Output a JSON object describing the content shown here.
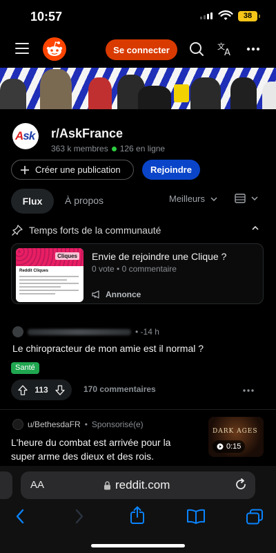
{
  "status_bar": {
    "time": "10:57",
    "battery": "38"
  },
  "header": {
    "connect_label": "Se connecter"
  },
  "community": {
    "avatar_text_a": "A",
    "avatar_text_sk": "sk",
    "name": "r/AskFrance",
    "members": "363 k membres",
    "online": "126 en ligne",
    "create_post_label": "Créer une publication",
    "join_label": "Rejoindre"
  },
  "tabs": {
    "feed": "Flux",
    "about": "À propos",
    "sort": "Meilleurs"
  },
  "highlights": {
    "title": "Temps forts de la communauté",
    "card": {
      "title": "Envie de rejoindre une Clique ?",
      "votes": "0 vote",
      "comments": "0 commentaire",
      "announcement": "Annonce",
      "thumb_label": "Cliques",
      "thumb_heading": "Reddit Cliques"
    }
  },
  "post1": {
    "time": "• -14 h",
    "title": "Le chiropracteur de mon amie est il normal ?",
    "flair": "Santé",
    "score": "113",
    "comments": "170 commentaires"
  },
  "post2": {
    "author": "u/BethesdaFR",
    "sponsored": "Sponsorisé(e)",
    "title": "L'heure du combat est arrivée pour la super arme des dieux et des rois.",
    "thumb_text": "DARK AGES",
    "duration": "0:15"
  },
  "browser": {
    "text_size": "AA",
    "domain": "reddit.com"
  },
  "colors": {
    "brand": "#ff4500",
    "connect": "#d93a00",
    "join": "#0a45c9",
    "flair": "#20a650",
    "ios_blue": "#0a84ff"
  }
}
